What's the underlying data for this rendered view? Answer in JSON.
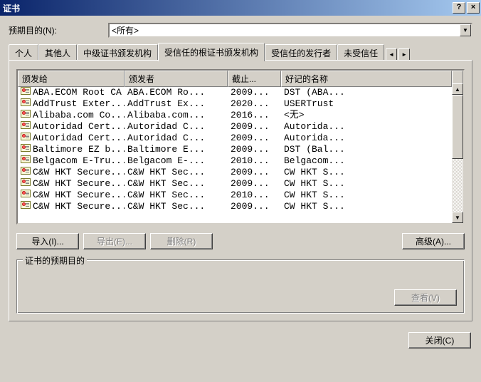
{
  "window": {
    "title": "证书",
    "help": "?",
    "close": "×"
  },
  "purpose": {
    "label": "预期目的(N):",
    "value": "<所有>"
  },
  "tabs": [
    {
      "label": "个人",
      "active": false
    },
    {
      "label": "其他人",
      "active": false
    },
    {
      "label": "中级证书颁发机构",
      "active": false
    },
    {
      "label": "受信任的根证书颁发机构",
      "active": true
    },
    {
      "label": "受信任的发行者",
      "active": false
    },
    {
      "label": "未受信任",
      "active": false
    }
  ],
  "tabscroll": {
    "left": "◄",
    "right": "►"
  },
  "columns": [
    "颁发给",
    "颁发者",
    "截止...",
    "好记的名称"
  ],
  "rows": [
    {
      "c0": "ABA.ECOM Root CA",
      "c1": "ABA.ECOM Ro...",
      "c2": "2009...",
      "c3": "DST (ABA..."
    },
    {
      "c0": "AddTrust Exter...",
      "c1": "AddTrust Ex...",
      "c2": "2020...",
      "c3": "USERTrust"
    },
    {
      "c0": "Alibaba.com Co...",
      "c1": "Alibaba.com...",
      "c2": "2016...",
      "c3": "<无>"
    },
    {
      "c0": "Autoridad Cert...",
      "c1": "Autoridad C...",
      "c2": "2009...",
      "c3": "Autorida..."
    },
    {
      "c0": "Autoridad Cert...",
      "c1": "Autoridad C...",
      "c2": "2009...",
      "c3": "Autorida..."
    },
    {
      "c0": "Baltimore EZ b...",
      "c1": "Baltimore E...",
      "c2": "2009...",
      "c3": "DST (Bal..."
    },
    {
      "c0": "Belgacom E-Tru...",
      "c1": "Belgacom E-...",
      "c2": "2010...",
      "c3": "Belgacom..."
    },
    {
      "c0": "C&W HKT Secure...",
      "c1": "C&W HKT Sec...",
      "c2": "2009...",
      "c3": "CW HKT S..."
    },
    {
      "c0": "C&W HKT Secure...",
      "c1": "C&W HKT Sec...",
      "c2": "2009...",
      "c3": "CW HKT S..."
    },
    {
      "c0": "C&W HKT Secure...",
      "c1": "C&W HKT Sec...",
      "c2": "2010...",
      "c3": "CW HKT S..."
    },
    {
      "c0": "C&W HKT Secure...",
      "c1": "C&W HKT Sec...",
      "c2": "2009...",
      "c3": "CW HKT S..."
    }
  ],
  "buttons": {
    "import": "导入(I)...",
    "export": "导出(E)...",
    "delete": "删除(R)",
    "advanced": "高级(A)...",
    "view": "查看(V)",
    "close": "关闭(C)"
  },
  "groupbox": {
    "title": "证书的预期目的"
  },
  "scroll": {
    "up": "▲",
    "down": "▼"
  }
}
